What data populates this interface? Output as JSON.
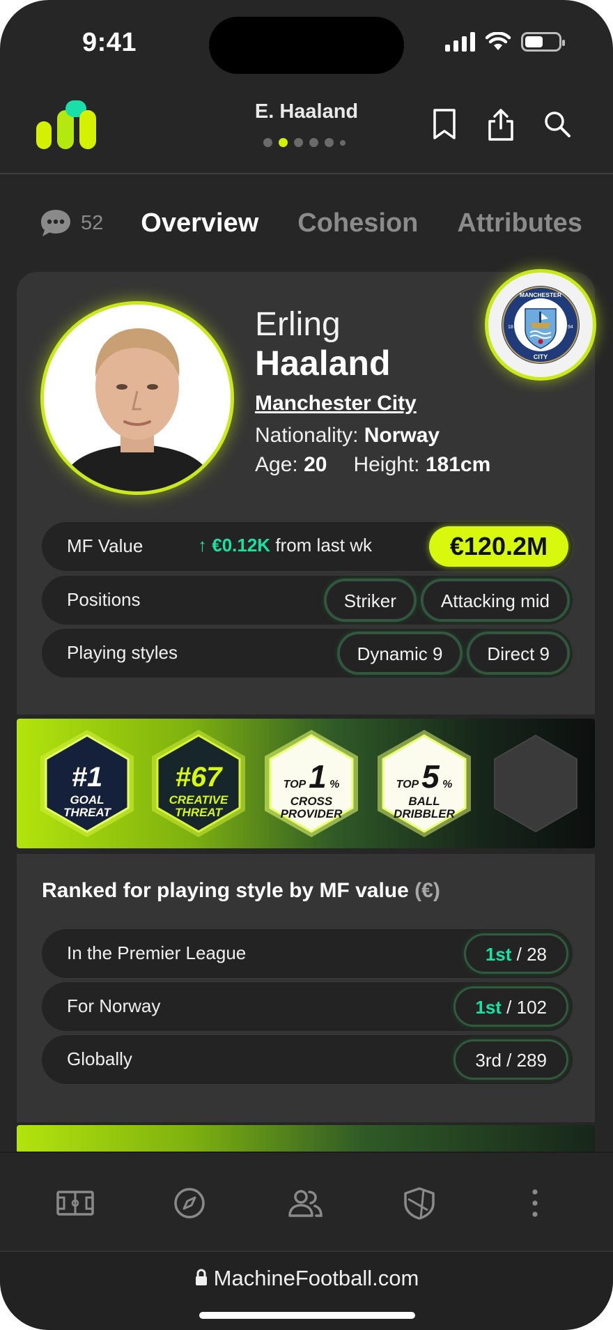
{
  "status": {
    "time": "9:41"
  },
  "header": {
    "title": "E. Haaland"
  },
  "tabs": {
    "comment_count": "52",
    "items": [
      "Overview",
      "Cohesion",
      "Attributes"
    ]
  },
  "player": {
    "first_name": "Erling",
    "last_name": "Haaland",
    "club": "Manchester City",
    "nationality_label": "Nationality:",
    "nationality": "Norway",
    "age_label": "Age:",
    "age": "20",
    "height_label": "Height:",
    "height": "181cm",
    "club_badge": {
      "top_text": "MANCHESTER",
      "bottom_text": "CITY",
      "left_num": "18",
      "right_num": "94"
    }
  },
  "mf_value": {
    "label": "MF Value",
    "change": "€0.12K",
    "change_suffix": "from last wk",
    "value": "€120.2M"
  },
  "positions": {
    "label": "Positions",
    "items": [
      "Striker",
      "Attacking mid"
    ]
  },
  "playing_styles": {
    "label": "Playing styles",
    "items": [
      "Dynamic 9",
      "Direct 9"
    ]
  },
  "badges": [
    {
      "big": "#1",
      "line1": "GOAL",
      "line2": "THREAT"
    },
    {
      "big": "#67",
      "line1": "CREATIVE",
      "line2": "THREAT"
    },
    {
      "prefix": "TOP",
      "big": "1",
      "suffix": "%",
      "line1": "CROSS",
      "line2": "PROVIDER"
    },
    {
      "prefix": "TOP",
      "big": "5",
      "suffix": "%",
      "line1": "BALL",
      "line2": "DRIBBLER"
    }
  ],
  "ranking": {
    "title": "Ranked for playing style by MF value",
    "title_suffix": "(€)",
    "rows": [
      {
        "label": "In the Premier League",
        "rank": "1st",
        "total": "/ 28"
      },
      {
        "label": "For Norway",
        "rank": "1st",
        "total": "/ 102"
      },
      {
        "label": "Globally",
        "rank": "3rd",
        "total": "/ 289"
      }
    ]
  },
  "browser": {
    "url": "MachineFootball.com"
  },
  "colors": {
    "accent": "#d8f90e",
    "positive": "#17e3a0",
    "background": "#262626",
    "card": "#353535"
  },
  "icons": [
    "bookmark-icon",
    "share-icon",
    "search-icon",
    "comment-icon",
    "pitch-icon",
    "compass-icon",
    "users-icon",
    "shield-icon",
    "more-icon",
    "lock-icon"
  ]
}
